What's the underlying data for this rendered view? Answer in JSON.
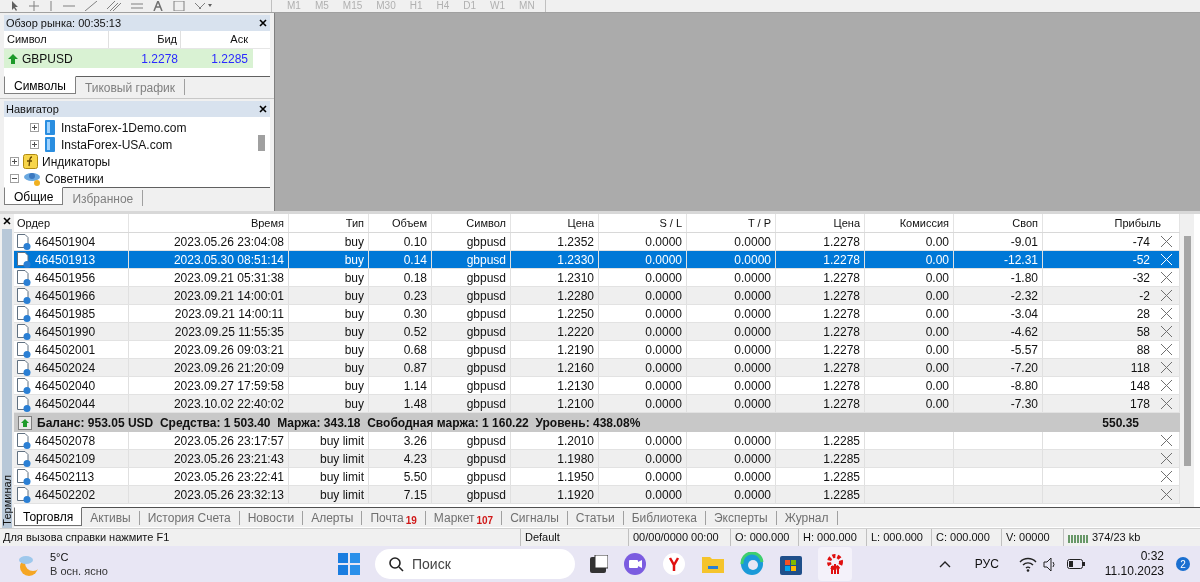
{
  "toolbar": {
    "timeframes": [
      "M1",
      "M5",
      "M15",
      "M30",
      "H1",
      "H4",
      "D1",
      "W1",
      "MN"
    ]
  },
  "market_watch": {
    "title": "Обзор рынка: 00:35:13",
    "columns": [
      "Символ",
      "Бид",
      "Аск"
    ],
    "rows": [
      {
        "symbol": "GBPUSD",
        "bid": "1.2278",
        "ask": "1.2285",
        "color": "#1e9a2a"
      }
    ],
    "tabs": [
      {
        "label": "Символы",
        "selected": true
      },
      {
        "label": "Тиковый график",
        "selected": false
      }
    ]
  },
  "navigator": {
    "title": "Навигатор",
    "items": [
      {
        "label": "InstaForex-1Demo.com",
        "kind": "server",
        "expanded": false
      },
      {
        "label": "InstaForex-USA.com",
        "kind": "server",
        "expanded": false
      },
      {
        "label": "Индикаторы",
        "kind": "indicators",
        "expanded": false
      },
      {
        "label": "Советники",
        "kind": "experts",
        "expanded": true
      }
    ],
    "tabs": [
      {
        "label": "Общие",
        "selected": true
      },
      {
        "label": "Избранное",
        "selected": false
      }
    ]
  },
  "terminal": {
    "side_label": "Терминал",
    "columns": [
      "Ордер",
      "Время",
      "Тип",
      "Объем",
      "Символ",
      "Цена",
      "S / L",
      "T / P",
      "Цена",
      "Комиссия",
      "Своп",
      "Прибыль"
    ],
    "rows": [
      {
        "order": "464501904",
        "time": "2023.05.26 23:04:08",
        "type": "buy",
        "volume": "0.10",
        "symbol": "gbpusd",
        "price": "1.2352",
        "sl": "0.0000",
        "tp": "0.0000",
        "current": "1.2278",
        "commission": "0.00",
        "swap": "-9.01",
        "profit": "-74",
        "selected": false
      },
      {
        "order": "464501913",
        "time": "2023.05.30 08:51:14",
        "type": "buy",
        "volume": "0.14",
        "symbol": "gbpusd",
        "price": "1.2330",
        "sl": "0.0000",
        "tp": "0.0000",
        "current": "1.2278",
        "commission": "0.00",
        "swap": "-12.31",
        "profit": "-52",
        "selected": true
      },
      {
        "order": "464501956",
        "time": "2023.09.21 05:31:38",
        "type": "buy",
        "volume": "0.18",
        "symbol": "gbpusd",
        "price": "1.2310",
        "sl": "0.0000",
        "tp": "0.0000",
        "current": "1.2278",
        "commission": "0.00",
        "swap": "-1.80",
        "profit": "-32",
        "selected": false
      },
      {
        "order": "464501966",
        "time": "2023.09.21 14:00:01",
        "type": "buy",
        "volume": "0.23",
        "symbol": "gbpusd",
        "price": "1.2280",
        "sl": "0.0000",
        "tp": "0.0000",
        "current": "1.2278",
        "commission": "0.00",
        "swap": "-2.32",
        "profit": "-2",
        "selected": false
      },
      {
        "order": "464501985",
        "time": "2023.09.21 14:00:11",
        "type": "buy",
        "volume": "0.30",
        "symbol": "gbpusd",
        "price": "1.2250",
        "sl": "0.0000",
        "tp": "0.0000",
        "current": "1.2278",
        "commission": "0.00",
        "swap": "-3.04",
        "profit": "28",
        "selected": false
      },
      {
        "order": "464501990",
        "time": "2023.09.25 11:55:35",
        "type": "buy",
        "volume": "0.52",
        "symbol": "gbpusd",
        "price": "1.2220",
        "sl": "0.0000",
        "tp": "0.0000",
        "current": "1.2278",
        "commission": "0.00",
        "swap": "-4.62",
        "profit": "58",
        "selected": false
      },
      {
        "order": "464502001",
        "time": "2023.09.26 09:03:21",
        "type": "buy",
        "volume": "0.68",
        "symbol": "gbpusd",
        "price": "1.2190",
        "sl": "0.0000",
        "tp": "0.0000",
        "current": "1.2278",
        "commission": "0.00",
        "swap": "-5.57",
        "profit": "88",
        "selected": false
      },
      {
        "order": "464502024",
        "time": "2023.09.26 21:20:09",
        "type": "buy",
        "volume": "0.87",
        "symbol": "gbpusd",
        "price": "1.2160",
        "sl": "0.0000",
        "tp": "0.0000",
        "current": "1.2278",
        "commission": "0.00",
        "swap": "-7.20",
        "profit": "118",
        "selected": false
      },
      {
        "order": "464502040",
        "time": "2023.09.27 17:59:58",
        "type": "buy",
        "volume": "1.14",
        "symbol": "gbpusd",
        "price": "1.2130",
        "sl": "0.0000",
        "tp": "0.0000",
        "current": "1.2278",
        "commission": "0.00",
        "swap": "-8.80",
        "profit": "148",
        "selected": false
      },
      {
        "order": "464502044",
        "time": "2023.10.02 22:40:02",
        "type": "buy",
        "volume": "1.48",
        "symbol": "gbpusd",
        "price": "1.2100",
        "sl": "0.0000",
        "tp": "0.0000",
        "current": "1.2278",
        "commission": "0.00",
        "swap": "-7.30",
        "profit": "178",
        "selected": false
      }
    ],
    "summary": {
      "text": "Баланс: 953.05 USD  Средства: 1 503.40  Маржа: 343.18  Свободная маржа: 1 160.22  Уровень: 438.08%",
      "profit": "550.35"
    },
    "pending": [
      {
        "order": "464502078",
        "time": "2023.05.26 23:17:57",
        "type": "buy limit",
        "volume": "3.26",
        "symbol": "gbpusd",
        "price": "1.2010",
        "sl": "0.0000",
        "tp": "0.0000",
        "current": "1.2285",
        "selected": false
      },
      {
        "order": "464502109",
        "time": "2023.05.26 23:21:43",
        "type": "buy limit",
        "volume": "4.23",
        "symbol": "gbpusd",
        "price": "1.1980",
        "sl": "0.0000",
        "tp": "0.0000",
        "current": "1.2285",
        "selected": false
      },
      {
        "order": "464502113",
        "time": "2023.05.26 23:22:41",
        "type": "buy limit",
        "volume": "5.50",
        "symbol": "gbpusd",
        "price": "1.1950",
        "sl": "0.0000",
        "tp": "0.0000",
        "current": "1.2285",
        "selected": false
      },
      {
        "order": "464502202",
        "time": "2023.05.26 23:32:13",
        "type": "buy limit",
        "volume": "7.15",
        "symbol": "gbpusd",
        "price": "1.1920",
        "sl": "0.0000",
        "tp": "0.0000",
        "current": "1.2285",
        "selected": false
      }
    ],
    "tabs": [
      {
        "label": "Торговля",
        "selected": true
      },
      {
        "label": "Активы",
        "selected": false
      },
      {
        "label": "История Счета",
        "selected": false
      },
      {
        "label": "Новости",
        "selected": false
      },
      {
        "label": "Алерты",
        "selected": false
      },
      {
        "label": "Почта",
        "badge": "19",
        "selected": false
      },
      {
        "label": "Маркет",
        "badge": "107",
        "selected": false
      },
      {
        "label": "Сигналы",
        "selected": false
      },
      {
        "label": "Статьи",
        "selected": false
      },
      {
        "label": "Библиотека",
        "selected": false
      },
      {
        "label": "Эксперты",
        "selected": false
      },
      {
        "label": "Журнал",
        "selected": false
      }
    ]
  },
  "status_bar": {
    "help": "Для вызова справки нажмите F1",
    "profile": "Default",
    "fields": [
      "00/00/0000 00:00",
      "O: 000.000",
      "H: 000.000",
      "L: 000.000",
      "C: 000.000",
      "V: 00000"
    ],
    "traffic": "374/23 kb"
  },
  "taskbar": {
    "temperature": "5°C",
    "weather": "В осн. ясно",
    "search": {
      "placeholder": "Поиск"
    },
    "language": "РУС",
    "time": "0:32",
    "date": "11.10.2023",
    "notifications": "2"
  }
}
